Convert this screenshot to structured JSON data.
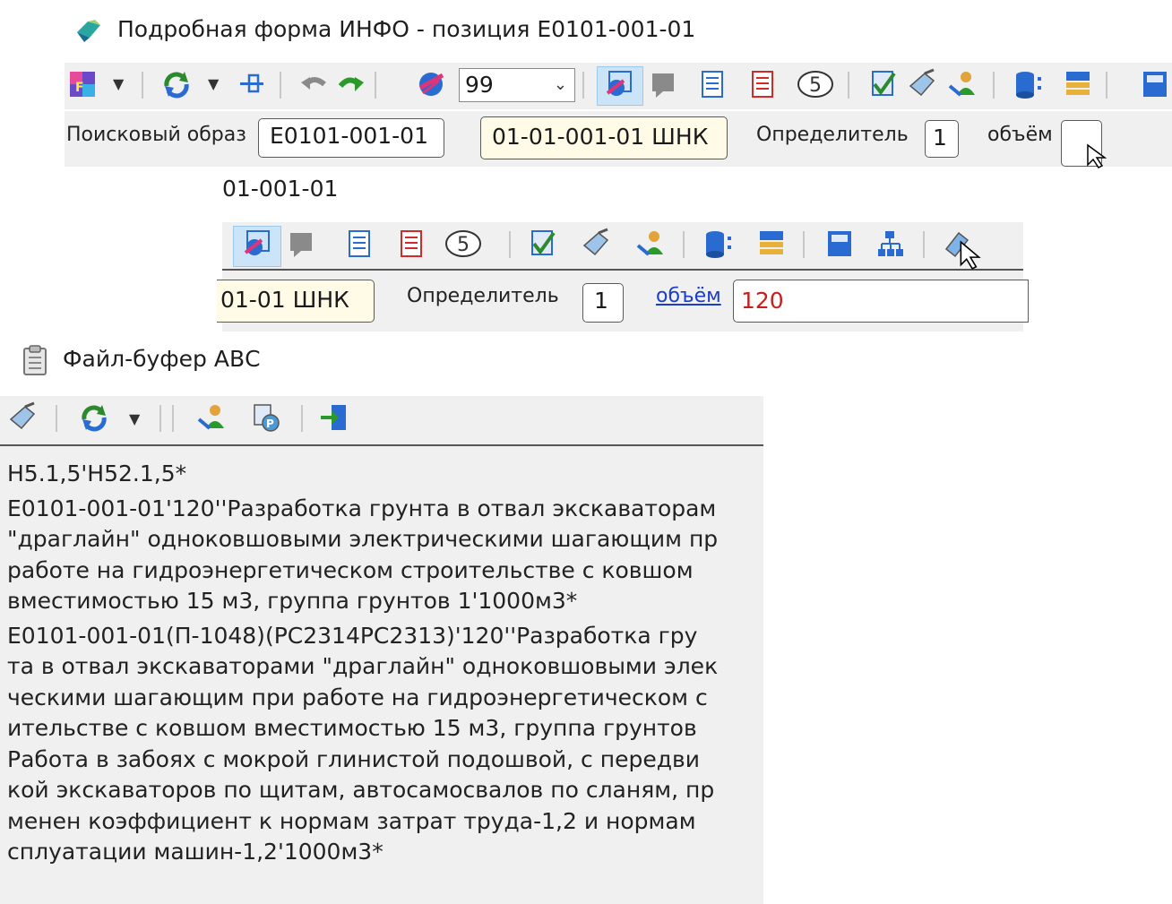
{
  "window1": {
    "title": "Подробная форма ИНФО - позиция Е0101-001-01",
    "toolbar": {
      "zoom_value": "99",
      "icons": [
        "form-icon",
        "refresh-icon",
        "pin-icon",
        "undo-icon",
        "redo-icon",
        "globe-icon",
        "bookmark-icon",
        "gray-icon",
        "list-blue-icon",
        "list-red-icon",
        "five-circle-icon",
        "check-icon",
        "brush-icon",
        "user-icon",
        "database-icon",
        "stack-icon",
        "calc-icon"
      ]
    },
    "search_row": {
      "search_label": "Поисковый образ",
      "search_value": "Е0101-001-01",
      "code_value": "01-01-001-01 ШНК",
      "determinant_label": "Определитель",
      "determinant_value": "1",
      "volume_label": "объём",
      "volume_value": ""
    }
  },
  "window1_zoom": {
    "title_fragment": "01-001-01",
    "icons": [
      "globe-icon",
      "gray-icon",
      "list-blue-icon",
      "list-red-icon",
      "five-circle-icon",
      "check-icon",
      "brush-icon",
      "user-icon",
      "database-icon",
      "stack-icon",
      "calc-icon",
      "tree-icon",
      "edit-icon"
    ],
    "code_fragment": "01-01 ШНК",
    "determinant_label": "Определитель",
    "determinant_value": "1",
    "volume_link": "объём",
    "volume_value": "120"
  },
  "window2": {
    "title": "Файл-буфер АВС",
    "icons": [
      "brush-icon",
      "refresh-icon",
      "user-icon",
      "copy-icon",
      "exit-icon"
    ],
    "lines": [
      "Н5.1,5'Н52.1,5*",
      "Е0101-001-01'120''Разработка грунта в отвал экскаваторам",
      "\"драглайн\" одноковшовыми электрическими шагающим пр",
      "работе на гидроэнергетическом строительстве с ковшом",
      "вместимостью 15 м3, группа грунтов 1'1000м3*",
      "Е0101-001-01(П-1048)(РС2314РС2313)'120''Разработка гру",
      "та в отвал экскаваторами \"драглайн\" одноковшовыми элек",
      "ческими шагающим при работе на гидроэнергетическом с",
      "ительстве с ковшом вместимостью 15 м3, группа грунтов",
      "Работа в забоях с мокрой глинистой подошвой, с передви",
      "кой экскаваторов по щитам, автосамосвалов по сланям, пр",
      "менен коэффициент к нормам затрат труда-1,2 и нормам",
      "сплуатации машин-1,2'1000м3*"
    ]
  },
  "colors": {
    "accent_blue": "#1a3dcc",
    "pressed_bg": "#cce4f7",
    "toolbar_bg": "#f0f0f0"
  }
}
